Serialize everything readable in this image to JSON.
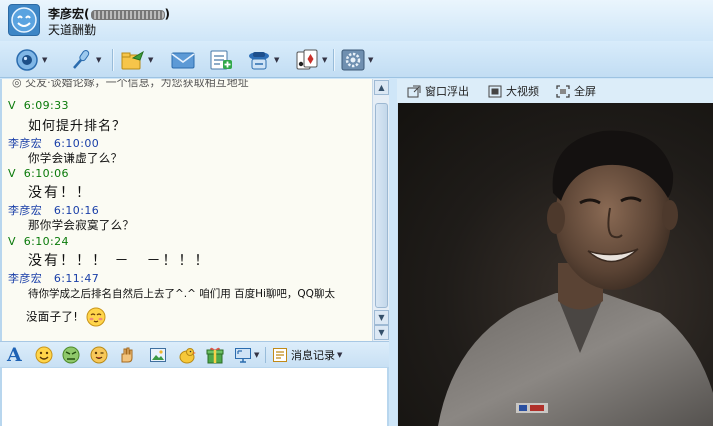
{
  "header": {
    "contact_name": "李彦宏",
    "contact_status": "天道酬勤"
  },
  "toolbar": {
    "items": [
      {
        "icon": "video-chat-icon",
        "has_dropdown": true
      },
      {
        "icon": "microphone-icon",
        "has_dropdown": true
      },
      {
        "icon": "send-file-icon",
        "has_dropdown": true
      },
      {
        "icon": "mail-icon",
        "has_dropdown": false
      },
      {
        "icon": "create-group-icon",
        "has_dropdown": false
      },
      {
        "icon": "remote-assist-icon",
        "has_dropdown": true
      },
      {
        "icon": "game-icon",
        "has_dropdown": true
      },
      {
        "icon": "settings-icon",
        "has_dropdown": true
      }
    ]
  },
  "chat": {
    "banner": "交友·谈婚论嫁，一个信息，为您获取相互地址",
    "messages": [
      {
        "sender": "V",
        "time": "6:09:33",
        "text": "如何提升排名？",
        "side": "me"
      },
      {
        "sender": "李彦宏",
        "time": "6:10:00",
        "text": "你学会谦虚了么？",
        "side": "other"
      },
      {
        "sender": "V",
        "time": "6:10:06",
        "text": "没有！！",
        "side": "me"
      },
      {
        "sender": "李彦宏",
        "time": "6:10:16",
        "text": "那你学会寂寞了么？",
        "side": "other"
      },
      {
        "sender": "V",
        "time": "6:10:24",
        "text": "没有！！！ －　－！！！",
        "side": "me"
      },
      {
        "sender": "李彦宏",
        "time": "6:11:47",
        "text": "待你学成之后排名自然后上去了^.^ 咱们用 百度Hi聊吧，QQ聊太",
        "side": "other"
      }
    ],
    "last_line": "没面子了!",
    "last_emoji": "shy-face-emoji"
  },
  "input_toolbar": {
    "items": [
      "font-icon",
      "smiley-icon",
      "angry-face-icon",
      "cheeky-face-icon",
      "hand-icon",
      "image-icon",
      "chicken-icon",
      "gift-icon",
      "screenshot-icon",
      "message-history-icon"
    ],
    "message_history_label": "消息记录"
  },
  "video": {
    "float_window_label": "窗口浮出",
    "large_video_label": "大视频",
    "fullscreen_label": "全屏"
  },
  "colors": {
    "my_header": "#0a7a0a",
    "other_header": "#1a3fa8",
    "chat_background": "#fbfbf3",
    "frame": "#cfe6f8"
  }
}
